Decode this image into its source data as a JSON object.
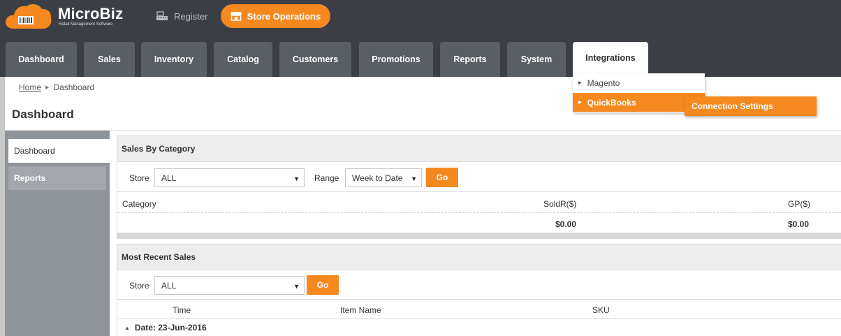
{
  "app": {
    "logo_title": "MicroBiz",
    "logo_subtitle": "Retail Management Software",
    "register_label": "Register",
    "store_ops_label": "Store Operations"
  },
  "nav": {
    "tabs": [
      {
        "label": "Dashboard"
      },
      {
        "label": "Sales"
      },
      {
        "label": "Inventory"
      },
      {
        "label": "Catalog"
      },
      {
        "label": "Customers"
      },
      {
        "label": "Promotions"
      },
      {
        "label": "Reports"
      },
      {
        "label": "System"
      },
      {
        "label": "Integrations"
      }
    ],
    "active_tab": "Integrations"
  },
  "integrations_menu": {
    "items": [
      {
        "label": "Magento"
      },
      {
        "label": "QuickBooks"
      }
    ],
    "submenu": {
      "label": "Connection Settings"
    }
  },
  "breadcrumb": {
    "home": "Home",
    "current": "Dashboard"
  },
  "page": {
    "title": "Dashboard"
  },
  "sidebar": {
    "items": [
      {
        "label": "Dashboard"
      },
      {
        "label": "Reports"
      }
    ]
  },
  "sales_by_category": {
    "title": "Sales By Category",
    "store_label": "Store",
    "store_value": "ALL",
    "range_label": "Range",
    "range_value": "Week to Date",
    "go_label": "Go",
    "columns": [
      "Category",
      "SoldR($)",
      "GP($)"
    ],
    "totals": {
      "sold": "$0.00",
      "gp": "$0.00"
    }
  },
  "most_recent_sales": {
    "title": "Most Recent Sales",
    "store_label": "Store",
    "store_value": "ALL",
    "go_label": "Go",
    "columns": [
      "Time",
      "Item Name",
      "SKU"
    ],
    "group_label": "Date: 23-Jun-2016"
  },
  "colors": {
    "accent": "#f5891f",
    "topbar": "#3b3f45",
    "tab": "#5a5f66",
    "sidebar": "#8f939a"
  }
}
